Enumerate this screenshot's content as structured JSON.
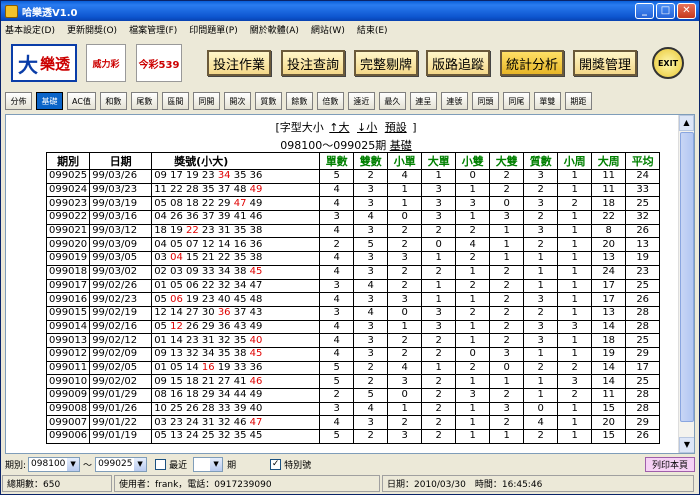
{
  "window": {
    "title": "哈樂透V1.0"
  },
  "menu": [
    "基本設定(D)",
    "更新開獎(O)",
    "檔案管理(F)",
    "印問題單(P)",
    "關於軟體(A)",
    "網站(W)",
    "結束(E)"
  ],
  "toolbar": {
    "logo1_mark": "大",
    "logo1_text": "樂透",
    "logo2_text": "威力彩",
    "logo3_text": "今彩539",
    "buttons": [
      "投注作業",
      "投注查詢",
      "完整剔牌",
      "版路追蹤",
      "統計分析",
      "開獎管理"
    ],
    "exit_label": "EXIT"
  },
  "subtoolbar": [
    "分佈",
    "基礎",
    "AC值",
    "和數",
    "尾數",
    "區間",
    "同開",
    "開次",
    "質數",
    "餘數",
    "倍數",
    "遠近",
    "最久",
    "連呈",
    "連號",
    "同頭",
    "同尾",
    "單雙",
    "期距"
  ],
  "content": {
    "fontsize_prefix": "[字型大小",
    "fontsize_up": "↑大",
    "fontsize_down": "↓小",
    "fontsize_default": "預設",
    "fontsize_suffix": "]",
    "period_range": "098100～099025期",
    "period_link": "基礎"
  },
  "table": {
    "headers": [
      "期別",
      "日期",
      "獎號(小大)",
      "單數",
      "雙數",
      "小單",
      "大單",
      "小雙",
      "大雙",
      "質數",
      "小周",
      "大周",
      "平均"
    ],
    "rows": [
      [
        "099025",
        "99/03/26",
        "09 17 19 23 34 35 36",
        "5",
        "2",
        "4",
        "1",
        "0",
        "2",
        "3",
        "1",
        "11",
        "24"
      ],
      [
        "099024",
        "99/03/23",
        "11 22 28 35 37 48 49",
        "4",
        "3",
        "1",
        "3",
        "1",
        "2",
        "2",
        "1",
        "11",
        "33"
      ],
      [
        "099023",
        "99/03/19",
        "05 08 18 22 29 47 49",
        "4",
        "3",
        "1",
        "3",
        "3",
        "0",
        "3",
        "2",
        "18",
        "25"
      ],
      [
        "099022",
        "99/03/16",
        "04 26 36 37 39 41 46",
        "3",
        "4",
        "0",
        "3",
        "1",
        "3",
        "2",
        "1",
        "22",
        "32"
      ],
      [
        "099021",
        "99/03/12",
        "18 19 22 23 31 35 38",
        "4",
        "3",
        "2",
        "2",
        "2",
        "1",
        "3",
        "1",
        "8",
        "26"
      ],
      [
        "099020",
        "99/03/09",
        "04 05 07 12 14 16 36",
        "2",
        "5",
        "2",
        "0",
        "4",
        "1",
        "2",
        "1",
        "20",
        "13"
      ],
      [
        "099019",
        "99/03/05",
        "03 04 15 21 22 35 38",
        "4",
        "3",
        "3",
        "1",
        "2",
        "1",
        "1",
        "1",
        "13",
        "19"
      ],
      [
        "099018",
        "99/03/02",
        "02 03 09 33 34 38 45",
        "4",
        "3",
        "2",
        "2",
        "1",
        "2",
        "1",
        "1",
        "24",
        "23"
      ],
      [
        "099017",
        "99/02/26",
        "01 05 06 22 32 34 47",
        "3",
        "4",
        "2",
        "1",
        "2",
        "2",
        "1",
        "1",
        "17",
        "25"
      ],
      [
        "099016",
        "99/02/23",
        "05 06 19 23 40 45 48",
        "4",
        "3",
        "3",
        "1",
        "1",
        "2",
        "3",
        "1",
        "17",
        "26"
      ],
      [
        "099015",
        "99/02/19",
        "12 14 27 30 36 37 43",
        "3",
        "4",
        "0",
        "3",
        "2",
        "2",
        "2",
        "1",
        "13",
        "28"
      ],
      [
        "099014",
        "99/02/16",
        "05 12 26 29 36 43 49",
        "4",
        "3",
        "1",
        "3",
        "1",
        "2",
        "3",
        "3",
        "14",
        "28"
      ],
      [
        "099013",
        "99/02/12",
        "01 14 23 31 32 35 40",
        "4",
        "3",
        "2",
        "2",
        "1",
        "2",
        "3",
        "1",
        "18",
        "25"
      ],
      [
        "099012",
        "99/02/09",
        "09 13 32 34 35 38 45",
        "4",
        "3",
        "2",
        "2",
        "0",
        "3",
        "1",
        "1",
        "19",
        "29"
      ],
      [
        "099011",
        "99/02/05",
        "01 05 14 16 19 33 36",
        "5",
        "2",
        "4",
        "1",
        "2",
        "0",
        "2",
        "2",
        "14",
        "17"
      ],
      [
        "099010",
        "99/02/02",
        "09 15 18 21 27 41 46",
        "5",
        "2",
        "3",
        "2",
        "1",
        "1",
        "1",
        "3",
        "14",
        "25"
      ],
      [
        "099009",
        "99/01/29",
        "08 16 18 29 34 44 49",
        "2",
        "5",
        "0",
        "2",
        "3",
        "2",
        "1",
        "2",
        "11",
        "28"
      ],
      [
        "099008",
        "99/01/26",
        "10 25 26 28 33 39 40",
        "3",
        "4",
        "1",
        "2",
        "1",
        "3",
        "0",
        "1",
        "15",
        "28"
      ],
      [
        "099007",
        "99/01/22",
        "03 23 24 31 32 46 47",
        "4",
        "3",
        "2",
        "2",
        "1",
        "2",
        "4",
        "1",
        "20",
        "29"
      ],
      [
        "099006",
        "99/01/19",
        "05 13 24 25 32 35 45",
        "5",
        "2",
        "3",
        "2",
        "1",
        "1",
        "2",
        "1",
        "15",
        "26"
      ]
    ],
    "red_numbers": [
      [
        "34"
      ],
      [
        "49"
      ],
      [
        "47"
      ],
      [],
      [
        "22"
      ],
      [],
      [
        "04"
      ],
      [
        "45"
      ],
      [],
      [
        "06"
      ],
      [
        "36"
      ],
      [
        "12"
      ],
      [
        "40"
      ],
      [
        "45"
      ],
      [
        "16"
      ],
      [
        "46"
      ],
      [],
      [],
      [
        "47"
      ],
      []
    ]
  },
  "filters": {
    "period_label": "期別:",
    "from": "098100",
    "tilde": "～",
    "to": "099025",
    "recent_label": "最近",
    "recent_value": "",
    "recent_unit": "期",
    "special_label": "特別號",
    "special_checked": "✓",
    "print_label": "列印本頁"
  },
  "status": {
    "total_label": "總期數：650",
    "user_label": "使用者：frank，電話：0917239090",
    "datetime_label": "日期：2010/03/30　時間：16:45:46"
  }
}
